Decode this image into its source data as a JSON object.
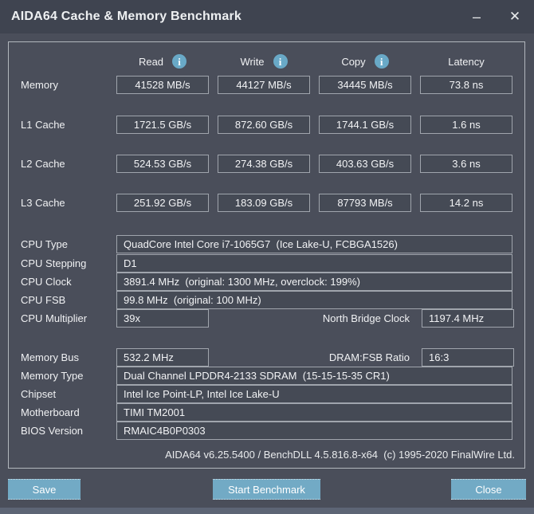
{
  "window": {
    "title": "AIDA64 Cache & Memory Benchmark",
    "minimize_glyph": "–",
    "close_glyph": "✕"
  },
  "icons": {
    "info_glyph": "i"
  },
  "benchmark": {
    "columns": [
      "Read",
      "Write",
      "Copy",
      "Latency"
    ],
    "rows": [
      {
        "label": "Memory",
        "read": "41528 MB/s",
        "write": "44127 MB/s",
        "copy": "34445 MB/s",
        "latency": "73.8 ns"
      },
      {
        "label": "L1 Cache",
        "read": "1721.5 GB/s",
        "write": "872.60 GB/s",
        "copy": "1744.1 GB/s",
        "latency": "1.6 ns"
      },
      {
        "label": "L2 Cache",
        "read": "524.53 GB/s",
        "write": "274.38 GB/s",
        "copy": "403.63 GB/s",
        "latency": "3.6 ns"
      },
      {
        "label": "L3 Cache",
        "read": "251.92 GB/s",
        "write": "183.09 GB/s",
        "copy": "87793 MB/s",
        "latency": "14.2 ns"
      }
    ]
  },
  "cpu_info": {
    "type": {
      "label": "CPU Type",
      "value": "QuadCore Intel Core i7-1065G7  (Ice Lake-U, FCBGA1526)"
    },
    "stepping": {
      "label": "CPU Stepping",
      "value": "D1"
    },
    "clock": {
      "label": "CPU Clock",
      "value": "3891.4 MHz  (original: 1300 MHz, overclock: 199%)"
    },
    "fsb": {
      "label": "CPU FSB",
      "value": "99.8 MHz  (original: 100 MHz)"
    },
    "multiplier": {
      "label": "CPU Multiplier",
      "value": "39x",
      "extra_label": "North Bridge Clock",
      "extra_value": "1197.4 MHz"
    }
  },
  "memory_info": {
    "bus": {
      "label": "Memory Bus",
      "value": "532.2 MHz",
      "extra_label": "DRAM:FSB Ratio",
      "extra_value": "16:3"
    },
    "type": {
      "label": "Memory Type",
      "value": "Dual Channel LPDDR4-2133 SDRAM  (15-15-15-35 CR1)"
    },
    "chipset": {
      "label": "Chipset",
      "value": "Intel Ice Point-LP, Intel Ice Lake-U"
    },
    "motherboard": {
      "label": "Motherboard",
      "value": "TIMI TM2001"
    },
    "bios": {
      "label": "BIOS Version",
      "value": "RMAIC4B0P0303"
    }
  },
  "footer": {
    "version_line": "AIDA64 v6.25.5400 / BenchDLL 4.5.816.8-x64  (c) 1995-2020 FinalWire Ltd."
  },
  "buttons": {
    "save": "Save",
    "start": "Start Benchmark",
    "close": "Close"
  },
  "colors": {
    "accent_blue": "#72aac5",
    "info_icon_blue": "#69a9c7",
    "background": "#4a4e5a",
    "titlebar": "#3f4450",
    "box_border": "#a0a5ad"
  }
}
